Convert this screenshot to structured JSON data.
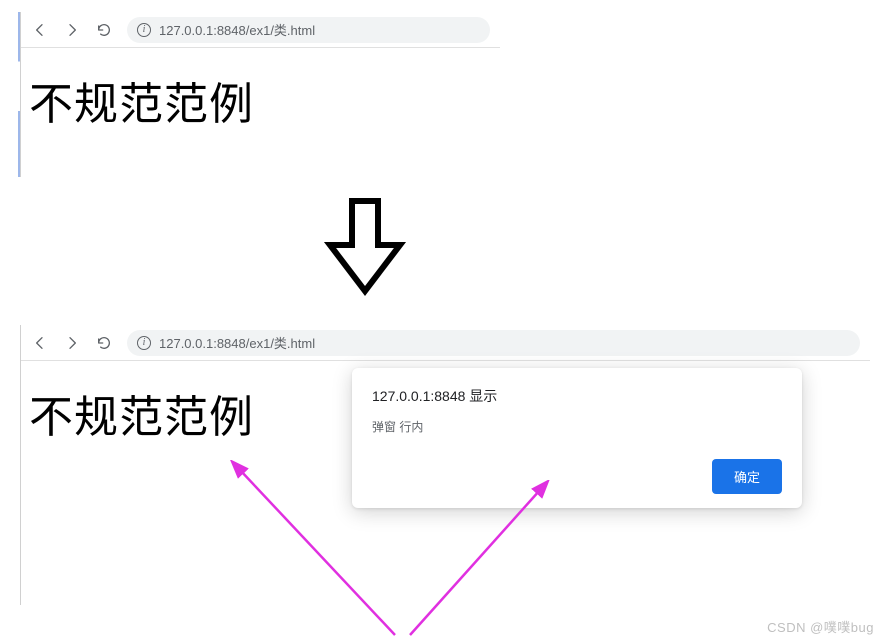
{
  "browser": {
    "url": "127.0.0.1:8848/ex1/类.html"
  },
  "page": {
    "heading": "不规范范例"
  },
  "dialog": {
    "title": "127.0.0.1:8848 显示",
    "message": "弹窗 行内",
    "ok_label": "确定"
  },
  "watermark": "CSDN @噗噗bug",
  "icons": {
    "back": "back-icon",
    "forward": "forward-icon",
    "reload": "reload-icon",
    "info": "info-icon"
  }
}
